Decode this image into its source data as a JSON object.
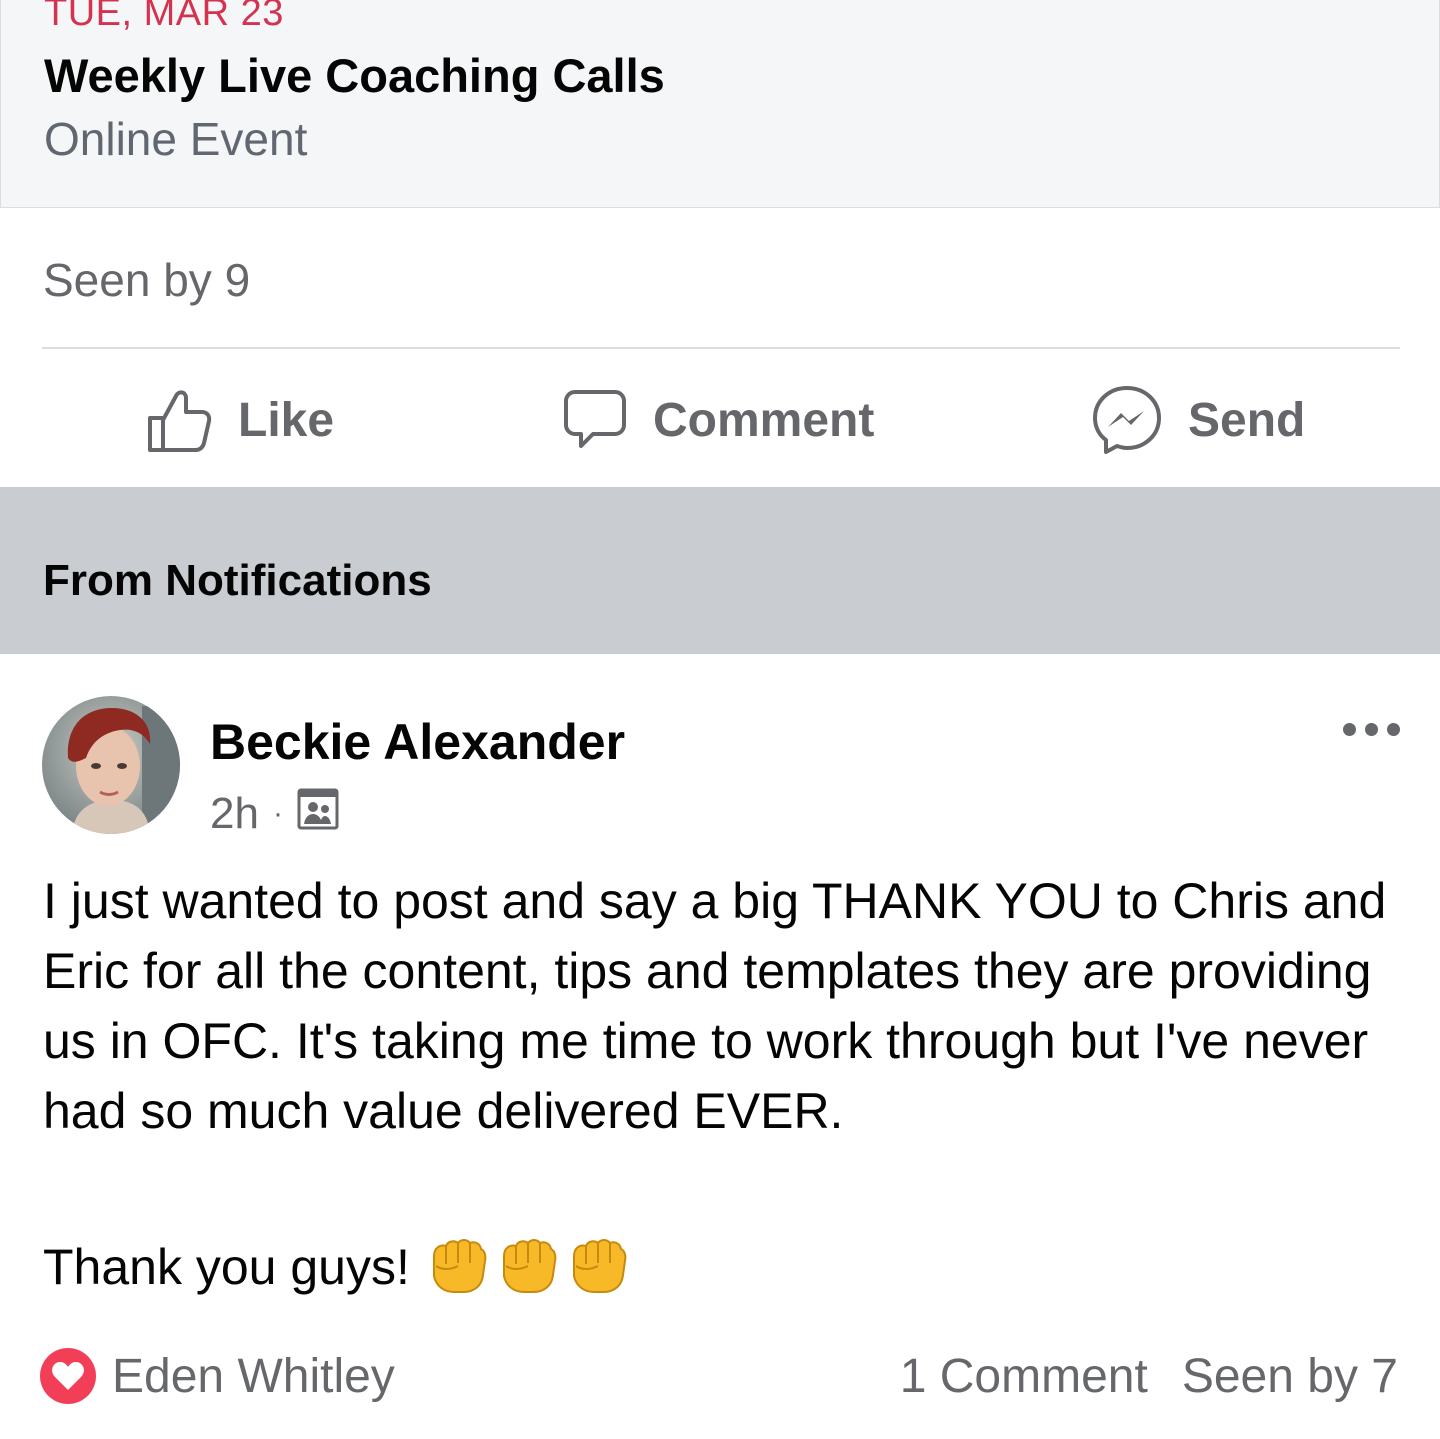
{
  "event": {
    "date": "TUE, MAR 23",
    "title": "Weekly Live Coaching Calls",
    "subtitle": "Online Event"
  },
  "event_post": {
    "seen_by": "Seen by 9"
  },
  "actions": {
    "like": "Like",
    "comment": "Comment",
    "send": "Send"
  },
  "section": {
    "title": "From Notifications"
  },
  "post": {
    "author": "Beckie Alexander",
    "time": "2h",
    "separator": "·",
    "audience_icon": "group-audience-icon",
    "body": "I just wanted to post and say a big THANK YOU to Chris and Eric for all the content, tips and templates they are providing us in OFC. It's taking me time to work through but I've never had so much value delivered EVER.",
    "closing": "Thank you guys!",
    "emoji_count": 3,
    "reactor": "Eden Whitley",
    "reaction_icon": "heart-icon",
    "comments": "1 Comment",
    "seen_by": "Seen by 7"
  },
  "colors": {
    "date_red": "#d4334f",
    "secondary_text": "#65676b",
    "band_gray": "#c9ccd1",
    "heart": "#f33e58"
  }
}
